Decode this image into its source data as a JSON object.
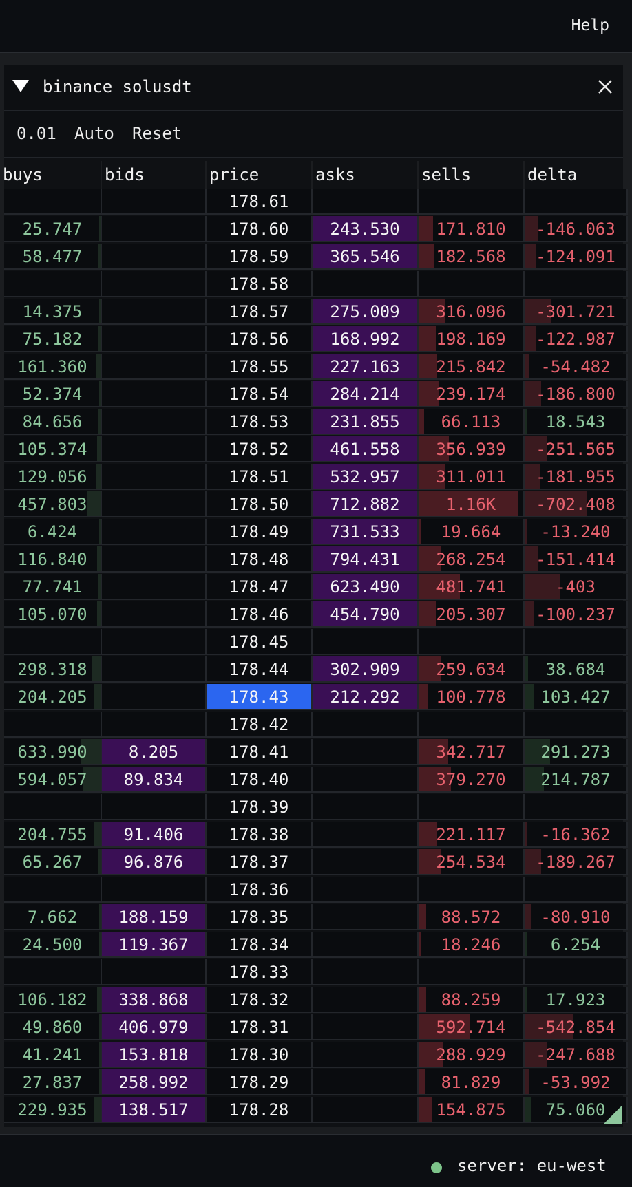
{
  "topbar": {
    "help_label": "Help"
  },
  "panel": {
    "title": "binance solusdt",
    "controls": {
      "tick_size": "0.01",
      "auto_label": "Auto",
      "reset_label": "Reset"
    }
  },
  "columns": [
    "buys",
    "bids",
    "price",
    "asks",
    "sells",
    "delta"
  ],
  "highlighted_price": "178.43",
  "colors": {
    "buy_text": "#8ec79d",
    "sell_text": "#e8626e",
    "ask_bg": "#3a0f55",
    "bid_bg": "#3a0f55",
    "highlight": "#2b66f0"
  },
  "rows": [
    {
      "buys": "",
      "bids": "",
      "price": "178.61",
      "asks": "",
      "sells": "",
      "delta": ""
    },
    {
      "buys": "25.747",
      "bids": "",
      "price": "178.60",
      "asks": "243.530",
      "sells": "171.810",
      "delta": "-146.063"
    },
    {
      "buys": "58.477",
      "bids": "",
      "price": "178.59",
      "asks": "365.546",
      "sells": "182.568",
      "delta": "-124.091"
    },
    {
      "buys": "",
      "bids": "",
      "price": "178.58",
      "asks": "",
      "sells": "",
      "delta": ""
    },
    {
      "buys": "14.375",
      "bids": "",
      "price": "178.57",
      "asks": "275.009",
      "sells": "316.096",
      "delta": "-301.721"
    },
    {
      "buys": "75.182",
      "bids": "",
      "price": "178.56",
      "asks": "168.992",
      "sells": "198.169",
      "delta": "-122.987"
    },
    {
      "buys": "161.360",
      "bids": "",
      "price": "178.55",
      "asks": "227.163",
      "sells": "215.842",
      "delta": "-54.482"
    },
    {
      "buys": "52.374",
      "bids": "",
      "price": "178.54",
      "asks": "284.214",
      "sells": "239.174",
      "delta": "-186.800"
    },
    {
      "buys": "84.656",
      "bids": "",
      "price": "178.53",
      "asks": "231.855",
      "sells": "66.113",
      "delta": "18.543"
    },
    {
      "buys": "105.374",
      "bids": "",
      "price": "178.52",
      "asks": "461.558",
      "sells": "356.939",
      "delta": "-251.565"
    },
    {
      "buys": "129.056",
      "bids": "",
      "price": "178.51",
      "asks": "532.957",
      "sells": "311.011",
      "delta": "-181.955"
    },
    {
      "buys": "457.803",
      "bids": "",
      "price": "178.50",
      "asks": "712.882",
      "sells": "1.16K",
      "delta": "-702.408"
    },
    {
      "buys": "6.424",
      "bids": "",
      "price": "178.49",
      "asks": "731.533",
      "sells": "19.664",
      "delta": "-13.240"
    },
    {
      "buys": "116.840",
      "bids": "",
      "price": "178.48",
      "asks": "794.431",
      "sells": "268.254",
      "delta": "-151.414"
    },
    {
      "buys": "77.741",
      "bids": "",
      "price": "178.47",
      "asks": "623.490",
      "sells": "481.741",
      "delta": "-403"
    },
    {
      "buys": "105.070",
      "bids": "",
      "price": "178.46",
      "asks": "454.790",
      "sells": "205.307",
      "delta": "-100.237"
    },
    {
      "buys": "",
      "bids": "",
      "price": "178.45",
      "asks": "",
      "sells": "",
      "delta": ""
    },
    {
      "buys": "298.318",
      "bids": "",
      "price": "178.44",
      "asks": "302.909",
      "sells": "259.634",
      "delta": "38.684"
    },
    {
      "buys": "204.205",
      "bids": "",
      "price": "178.43",
      "asks": "212.292",
      "sells": "100.778",
      "delta": "103.427"
    },
    {
      "buys": "",
      "bids": "",
      "price": "178.42",
      "asks": "",
      "sells": "",
      "delta": ""
    },
    {
      "buys": "633.990",
      "bids": "8.205",
      "price": "178.41",
      "asks": "",
      "sells": "342.717",
      "delta": "291.273"
    },
    {
      "buys": "594.057",
      "bids": "89.834",
      "price": "178.40",
      "asks": "",
      "sells": "379.270",
      "delta": "214.787"
    },
    {
      "buys": "",
      "bids": "",
      "price": "178.39",
      "asks": "",
      "sells": "",
      "delta": ""
    },
    {
      "buys": "204.755",
      "bids": "91.406",
      "price": "178.38",
      "asks": "",
      "sells": "221.117",
      "delta": "-16.362"
    },
    {
      "buys": "65.267",
      "bids": "96.876",
      "price": "178.37",
      "asks": "",
      "sells": "254.534",
      "delta": "-189.267"
    },
    {
      "buys": "",
      "bids": "",
      "price": "178.36",
      "asks": "",
      "sells": "",
      "delta": ""
    },
    {
      "buys": "7.662",
      "bids": "188.159",
      "price": "178.35",
      "asks": "",
      "sells": "88.572",
      "delta": "-80.910"
    },
    {
      "buys": "24.500",
      "bids": "119.367",
      "price": "178.34",
      "asks": "",
      "sells": "18.246",
      "delta": "6.254"
    },
    {
      "buys": "",
      "bids": "",
      "price": "178.33",
      "asks": "",
      "sells": "",
      "delta": ""
    },
    {
      "buys": "106.182",
      "bids": "338.868",
      "price": "178.32",
      "asks": "",
      "sells": "88.259",
      "delta": "17.923"
    },
    {
      "buys": "49.860",
      "bids": "406.979",
      "price": "178.31",
      "asks": "",
      "sells": "592.714",
      "delta": "-542.854"
    },
    {
      "buys": "41.241",
      "bids": "153.818",
      "price": "178.30",
      "asks": "",
      "sells": "288.929",
      "delta": "-247.688"
    },
    {
      "buys": "27.837",
      "bids": "258.992",
      "price": "178.29",
      "asks": "",
      "sells": "81.829",
      "delta": "-53.992"
    },
    {
      "buys": "229.935",
      "bids": "138.517",
      "price": "178.28",
      "asks": "",
      "sells": "154.875",
      "delta": "75.060"
    }
  ],
  "status": {
    "server_label": "server: eu-west"
  }
}
